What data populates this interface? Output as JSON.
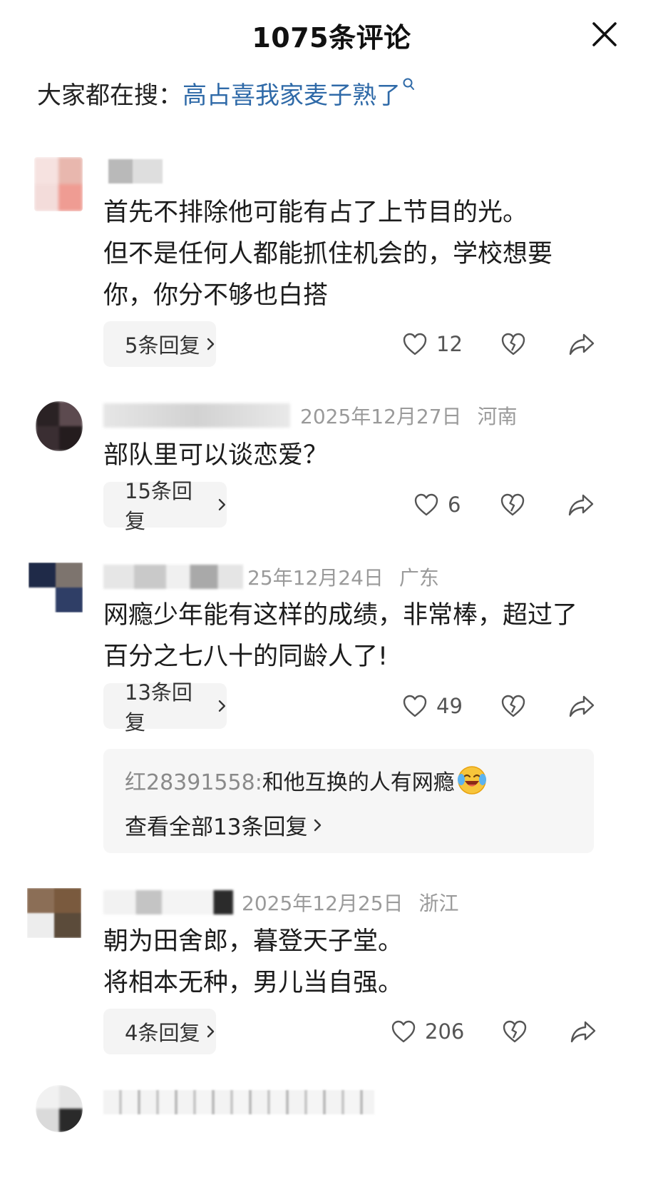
{
  "header": {
    "title": "1075条评论"
  },
  "search": {
    "label": "大家都在搜：",
    "link_text": "高占喜我家麦子熟了"
  },
  "comments": [
    {
      "date": "",
      "location": "",
      "text": "首先不排除他可能有占了上节目的光。\n但不是任何人都能抓住机会的，学校想要你，你分不够也白搭",
      "reply_label": "5条回复",
      "likes": "12"
    },
    {
      "date": "2025年12月27日",
      "location": "河南",
      "text": "部队里可以谈恋爱？",
      "reply_label": "15条回复",
      "likes": "6"
    },
    {
      "date": "25年12月24日",
      "location": "广东",
      "text": "网瘾少年能有这样的成绩，非常棒，超过了百分之七八十的同龄人了!",
      "reply_label": "13条回复",
      "likes": "49",
      "sub_reply": {
        "name": "红28391558:",
        "text": " 和他互换的人有网瘾",
        "more": "查看全部13条回复"
      }
    },
    {
      "date": "2025年12月25日",
      "location": "浙江",
      "text": "朝为田舍郎，暮登天子堂。\n将相本无种，男儿当自强。",
      "reply_label": "4条回复",
      "likes": "206"
    }
  ],
  "colors": {
    "link": "#2f6aa8",
    "meta": "#9a9a9a",
    "reply_bg": "#f4f4f4"
  },
  "icons": [
    "close-icon",
    "search-icon",
    "heart-icon",
    "broken-heart-icon",
    "share-icon",
    "chevron-right-icon",
    "laughing-crying-emoji"
  ]
}
